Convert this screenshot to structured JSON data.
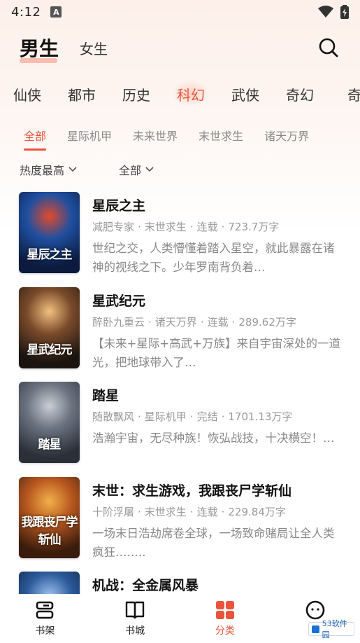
{
  "status_bar": {
    "time": "4:12",
    "app_badge": "A"
  },
  "header": {
    "tab_male": "男生",
    "tab_female": "女生"
  },
  "category_tabs": [
    "仙侠",
    "都市",
    "历史",
    "科幻",
    "武侠",
    "奇幻",
    "奇"
  ],
  "active_category_index": 3,
  "sub_tabs": [
    "全部",
    "星际机甲",
    "未来世界",
    "末世求生",
    "诸天万界"
  ],
  "filters": {
    "sort": "热度最高",
    "status": "全部"
  },
  "books": [
    {
      "title": "星辰之主",
      "author": "减肥专家",
      "genre": "末世求生",
      "status": "连载",
      "words": "723.7万字",
      "desc": "世纪之交，人类懵懂着踏入星空，就此暴露在诸神的视线之下。少年罗南背负着…",
      "cover_text": "星辰之主",
      "cover_colors": [
        "#0b1a3d",
        "#1f4fa0",
        "#e34a2a"
      ]
    },
    {
      "title": "星武纪元",
      "author": "醉卧九重云",
      "genre": "诸天万界",
      "status": "连载",
      "words": "289.62万字",
      "desc": "【未来+星际+高武+万族】来自宇宙深处的一道光，把地球带入了…",
      "cover_text": "星武纪元",
      "cover_colors": [
        "#1a1410",
        "#7a4a2a",
        "#f0c080"
      ]
    },
    {
      "title": "踏星",
      "author": "随散飘风",
      "genre": "星际机甲",
      "status": "完结",
      "words": "1701.13万字",
      "desc": "浩瀚宇宙，无尽种族！恢弘战技，十决横空！…",
      "cover_text": "踏星",
      "cover_colors": [
        "#2a2f38",
        "#6b7380",
        "#c9ced6"
      ]
    },
    {
      "title": "末世：求生游戏，我跟丧尸学斩仙",
      "author": "十阶浮屠",
      "genre": "末世求生",
      "status": "连载",
      "words": "229.84万字",
      "desc": "一场末日浩劫席卷全球，一场致命赌局让全人类疯狂……..",
      "cover_text": "我跟丧尸学斩仙",
      "cover_colors": [
        "#3a1c0c",
        "#b8581f",
        "#f2b04a"
      ]
    },
    {
      "title": "机战：全金属风暴",
      "author": "",
      "genre": "",
      "status": "",
      "words": "",
      "desc": "",
      "cover_text": "",
      "cover_colors": [
        "#0d1f3a",
        "#2c5b9c",
        "#9fc3f0"
      ]
    }
  ],
  "bottom_nav": [
    {
      "label": "书架",
      "icon": "bookshelf-icon"
    },
    {
      "label": "书城",
      "icon": "book-open-icon"
    },
    {
      "label": "分类",
      "icon": "category-grid-icon"
    },
    {
      "label": "我",
      "icon": "profile-icon"
    }
  ],
  "active_nav_index": 2,
  "watermark": "53软件园",
  "colors": {
    "accent": "#e8553b",
    "text": "#222222",
    "muted": "#999999"
  }
}
